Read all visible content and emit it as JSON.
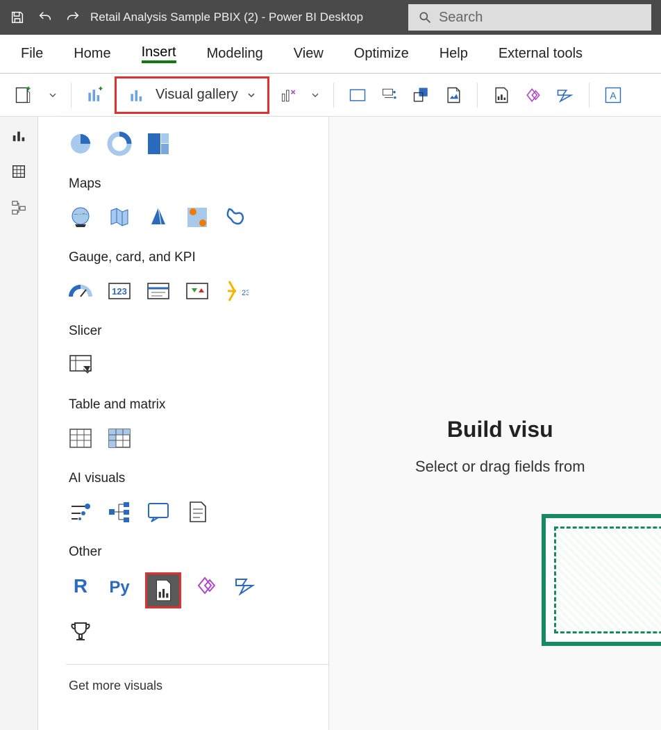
{
  "titlebar": {
    "title": "Retail Analysis Sample PBIX (2) - Power BI Desktop",
    "search_placeholder": "Search"
  },
  "menubar": {
    "items": [
      "File",
      "Home",
      "Insert",
      "Modeling",
      "View",
      "Optimize",
      "Help",
      "External tools"
    ],
    "active_index": 2
  },
  "toolbar": {
    "visual_gallery_label": "Visual gallery"
  },
  "gallery": {
    "pies_section_icons": [
      "pie-chart-icon",
      "donut-chart-icon",
      "treemap-icon"
    ],
    "maps_label": "Maps",
    "maps_icons": [
      "map-globe-icon",
      "filled-map-icon",
      "arcgis-icon",
      "azure-map-icon",
      "shape-map-icon"
    ],
    "gauge_label": "Gauge, card, and KPI",
    "gauge_icons": [
      "gauge-icon",
      "card-icon",
      "multi-row-card-icon",
      "kpi-icon",
      "kpi-number-icon"
    ],
    "slicer_label": "Slicer",
    "slicer_icons": [
      "slicer-icon"
    ],
    "table_label": "Table and matrix",
    "table_icons": [
      "table-icon",
      "matrix-icon"
    ],
    "ai_label": "AI visuals",
    "ai_icons": [
      "key-influencers-icon",
      "decomposition-tree-icon",
      "qa-icon",
      "smart-narrative-icon"
    ],
    "other_label": "Other",
    "other_icons": [
      "r-script-icon",
      "python-script-icon",
      "paginated-report-icon",
      "powerapps-icon",
      "powerautomate-icon",
      "trophy-icon"
    ],
    "get_more_label": "Get more visuals"
  },
  "canvas": {
    "build_title": "Build visu",
    "build_sub": "Select or drag fields from "
  }
}
